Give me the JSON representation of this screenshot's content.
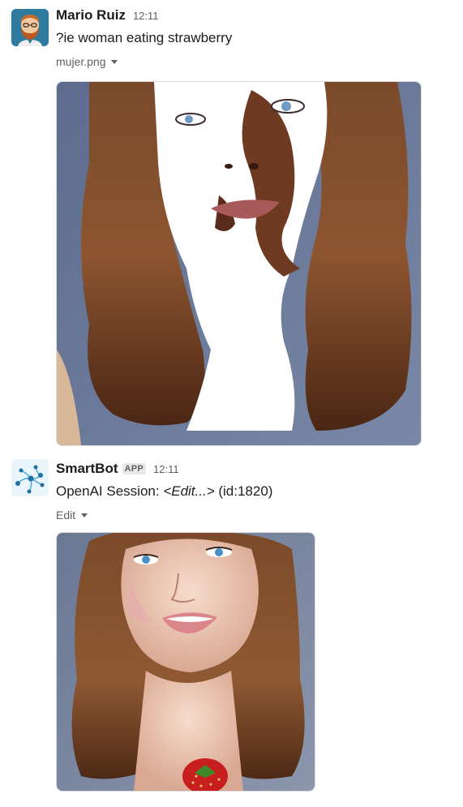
{
  "messages": [
    {
      "sender": "Mario Ruiz",
      "time": "12:11",
      "text": "?ie woman eating strawberry",
      "attachment": {
        "file_name": "mujer.png",
        "image_description_icon": "image-icon"
      },
      "avatar_icon": "bearded-man-avatar-icon",
      "avatar_bg": "#2b6e8f"
    },
    {
      "sender": "SmartBot",
      "badge": "APP",
      "time": "12:11",
      "text_prefix": "OpenAI Session: ",
      "text_link": "<Edit...>",
      "text_suffix": " (id:1820)",
      "attachment": {
        "file_name": "Edit"
      },
      "avatar_icon": "network-nodes-avatar-icon",
      "avatar_bg": "#e8f4fb"
    }
  ],
  "colors": {
    "text_primary": "#1d1c1d",
    "text_secondary": "#616061",
    "badge_bg": "#e8e8e8",
    "image_bg": "#6b7a98",
    "hair": "#6b3f22"
  }
}
